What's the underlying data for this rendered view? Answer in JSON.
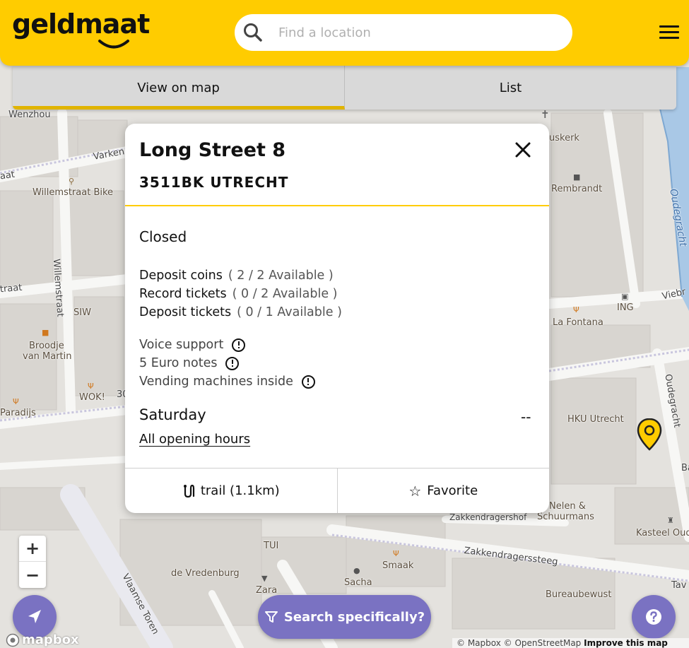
{
  "header": {
    "logo_text": "geldmaat",
    "search_placeholder": "Find a location",
    "brand_color": "#ffcc00"
  },
  "tabs": [
    {
      "label": "View on map",
      "active": true
    },
    {
      "label": "List",
      "active": false
    }
  ],
  "popup": {
    "street": "Long Street 8",
    "city": "3511BK UTRECHT",
    "status": "Closed",
    "services": [
      {
        "name": "Deposit coins",
        "availability": "( 2 / 2 Available )"
      },
      {
        "name": "Record tickets",
        "availability": "( 0 / 2 Available )"
      },
      {
        "name": "Deposit tickets",
        "availability": "( 0 / 1 Available )"
      }
    ],
    "features": [
      {
        "label": "Voice support",
        "icon": "info-icon"
      },
      {
        "label": "5 Euro notes",
        "icon": "info-icon"
      },
      {
        "label": "Vending machines inside",
        "icon": "info-icon"
      }
    ],
    "day": "Saturday",
    "hours": "--",
    "all_hours_link": "All opening hours",
    "route_label": "trail (1.1km)",
    "favorite_label": "Favorite"
  },
  "controls": {
    "zoom_in": "+",
    "zoom_out": "−",
    "search_specific_label": "Search specifically?",
    "button_color": "#7a72c2",
    "mapbox_logo": "mapbox",
    "attribution_prefix": "© Mapbox © OpenStreetMap",
    "attribution_link": "Improve this map"
  },
  "map": {
    "labels": [
      "Wenzhou",
      "Varken",
      "Willemstraat Bike",
      "Willemstraat",
      "SIW",
      "Broodje",
      "van Martin",
      "WOK!",
      "Paradijs",
      "uskerk",
      "Rembrandt",
      "Oudegracht",
      "ING",
      "La Fontana",
      "Viebr",
      "HKU Utrecht",
      "Oudegracht",
      "Nelen &",
      "Schuurmans",
      "Kasteel Oud",
      "Zakkendragershof",
      "Zakkendragerssteeg",
      "Smaak",
      "Sacha",
      "Bureaubewust",
      "TUI",
      "de Vredenburg",
      "Zara",
      "Vlaamse Toren",
      "Tav",
      "Ba",
      "aat",
      "traat",
      "30"
    ]
  }
}
